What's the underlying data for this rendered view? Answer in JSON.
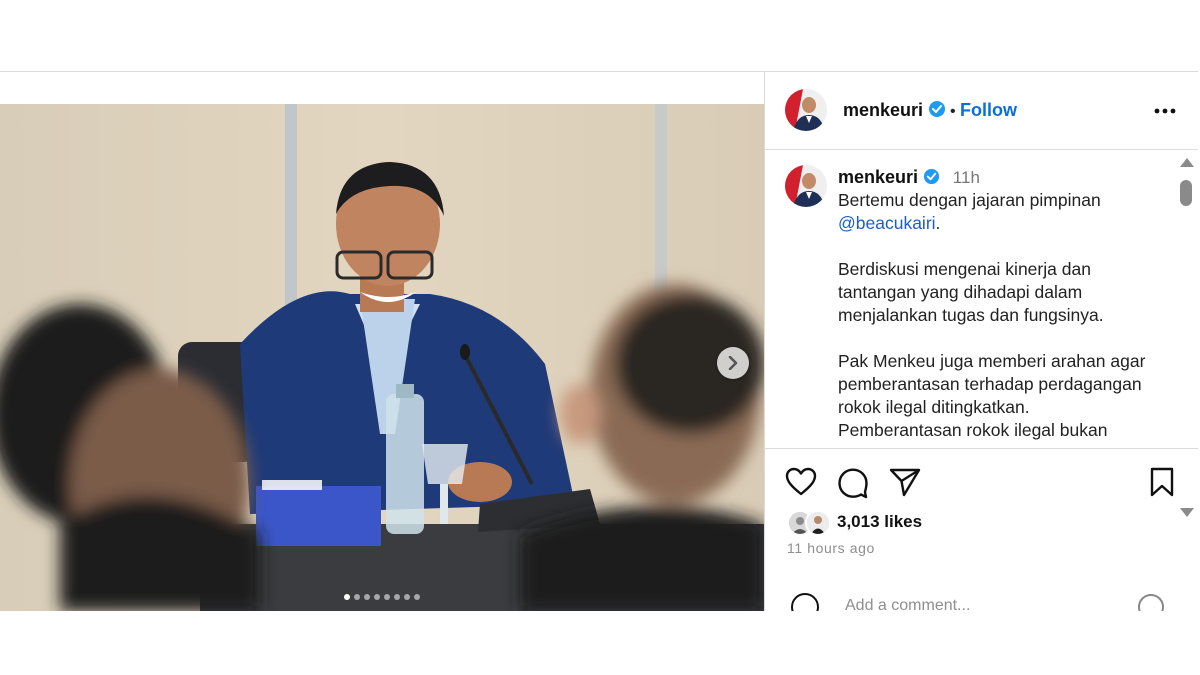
{
  "post": {
    "username": "menkeuri",
    "follow_label": "Follow",
    "separator": "•",
    "time_short": "11h",
    "caption": [
      "Bertemu dengan jajaran pimpinan",
      "@beacukairi",
      ".",
      "Berdiskusi mengenai kinerja dan",
      "tantangan yang dihadapi dalam",
      "menjalankan tugas dan fungsinya.",
      "Pak Menkeu juga memberi arahan agar",
      "pemberantasan terhadap perdagangan",
      "rokok ilegal ditingkatkan.",
      "Pemberantasan rokok ilegal bukan"
    ],
    "likes": "3,013 likes",
    "time_ago": "11 hours ago",
    "comment_placeholder": "Add a comment..."
  },
  "carousel": {
    "slide_count": 8,
    "active_index": 0
  },
  "icons": {
    "verified": "verified-badge-icon",
    "more": "more-options-icon",
    "like": "heart-icon",
    "comment": "comment-icon",
    "share": "share-icon",
    "save": "bookmark-icon",
    "next": "chevron-right-icon",
    "emoji": "emoji-icon"
  },
  "colors": {
    "link": "#1d5fc1",
    "follow": "#0a6fd6",
    "verified": "#1d9bf0",
    "muted": "#8e8e8e",
    "border": "#dbdbdb"
  }
}
